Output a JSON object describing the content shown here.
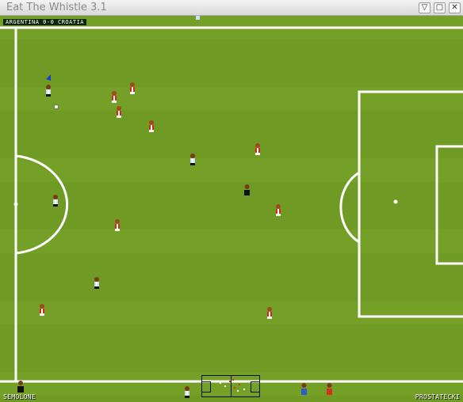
{
  "window": {
    "title": "Eat The Whistle 3.1",
    "buttons": [
      "▽",
      "▢",
      "✕"
    ]
  },
  "scoreboard": {
    "text": "ARGENTINA 0-0 CROATIA"
  },
  "players": {
    "home_name": "SEMOLONE",
    "away_name": "PROSTATECKI"
  },
  "colors": {
    "pitch": "#6f9b24",
    "lines": "#ffffff",
    "argentina_shirt": "#c6e2f4",
    "croatia_shirt": "#cf2b16",
    "referee": "#111111"
  }
}
